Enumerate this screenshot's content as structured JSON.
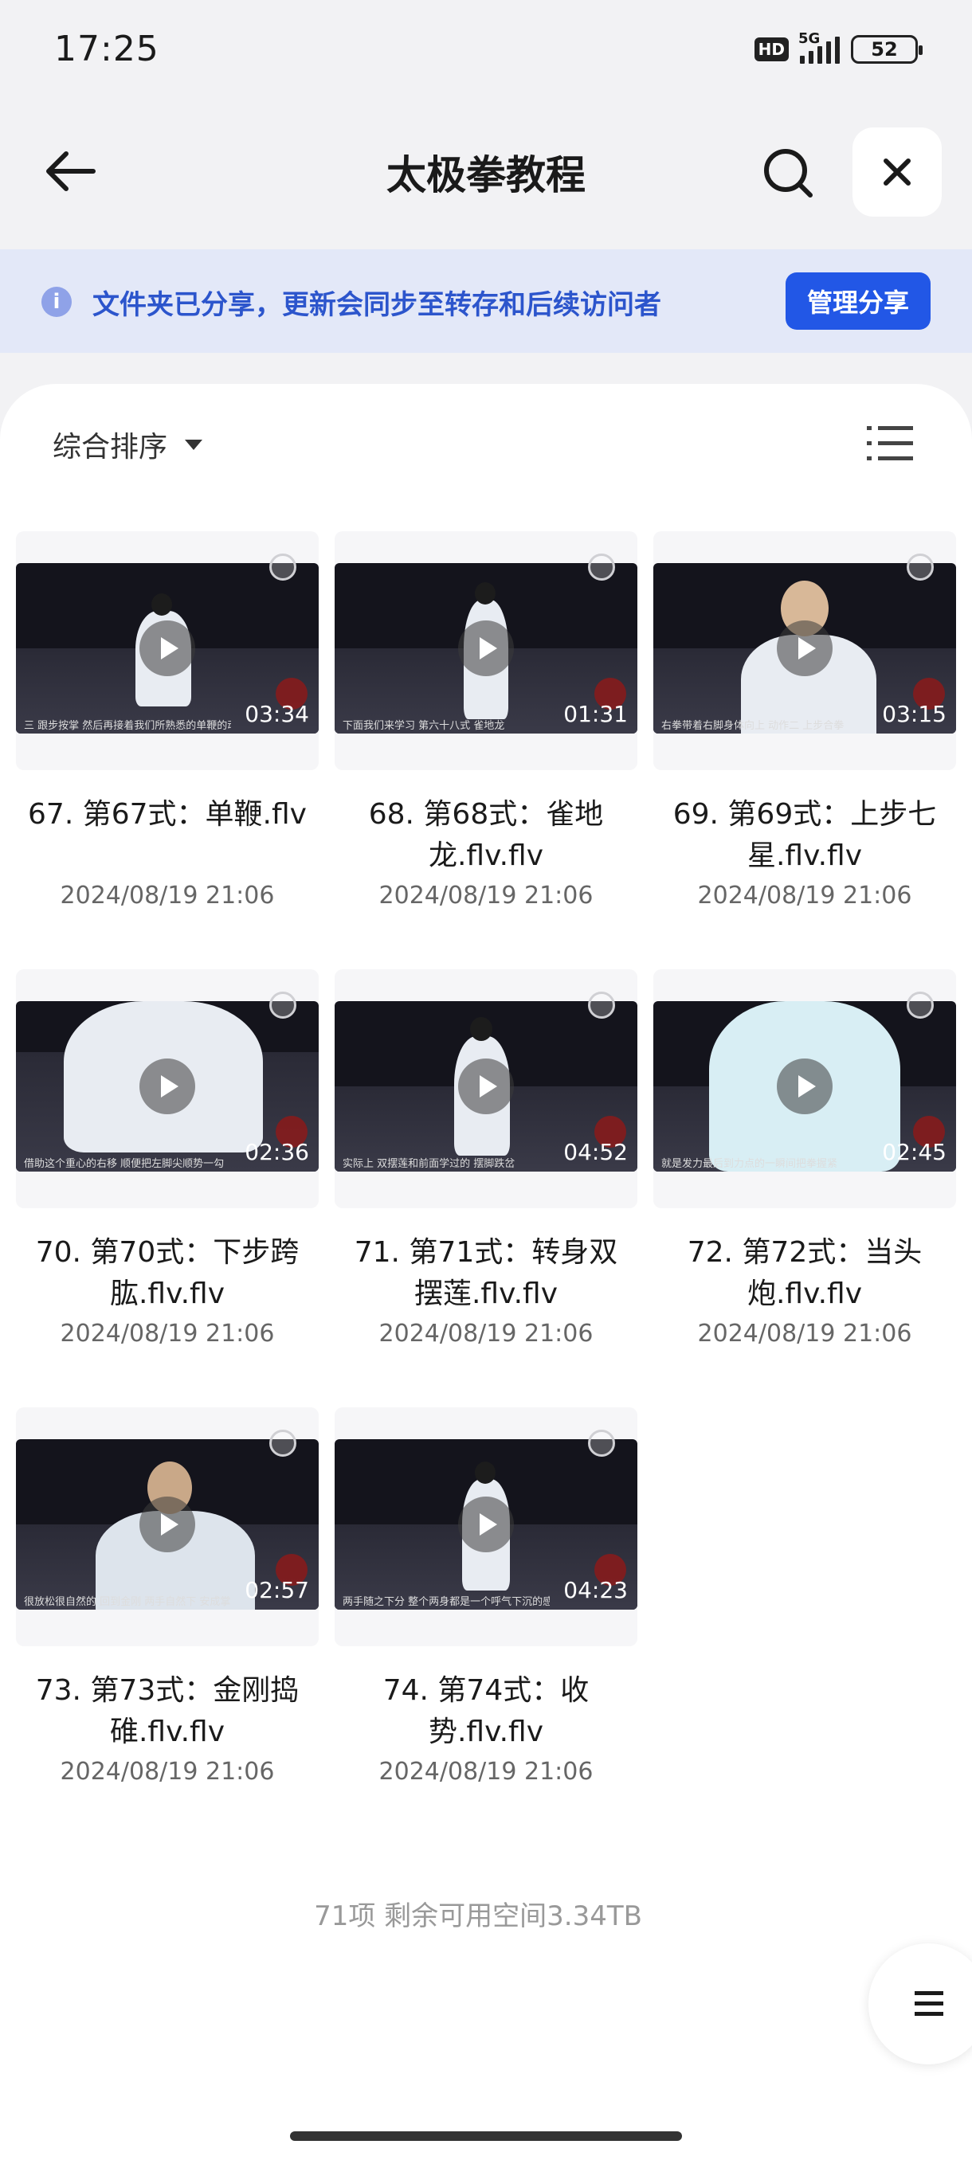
{
  "status_bar": {
    "time": "17:25",
    "hd": "HD",
    "network": "5G",
    "battery": "52"
  },
  "nav": {
    "title": "太极拳教程"
  },
  "share_banner": {
    "text": "文件夹已分享，更新会同步至转存和后续访问者",
    "button": "管理分享"
  },
  "sort": {
    "label": "综合排序"
  },
  "files": [
    {
      "name": "67. 第67式：单鞭.flv",
      "date": "2024/08/19 21:06",
      "duration": "03:34",
      "caption": "三 跟步按掌 然后再接着我们所熟悉的单鞭的动作"
    },
    {
      "name": "68. 第68式：雀地龙.flv.flv",
      "date": "2024/08/19 21:06",
      "duration": "01:31",
      "caption": "下面我们来学习 第六十八式 雀地龙"
    },
    {
      "name": "69. 第69式：上步七星.flv.flv",
      "date": "2024/08/19 21:06",
      "duration": "03:15",
      "caption": "右拳带着右脚身体向上 动作二 上步合拳"
    },
    {
      "name": "70. 第70式：下步跨肱.flv.flv",
      "date": "2024/08/19 21:06",
      "duration": "02:36",
      "caption": "借助这个重心的右移 顺便把左脚尖顺势一勾"
    },
    {
      "name": "71. 第71式：转身双摆莲.flv.flv",
      "date": "2024/08/19 21:06",
      "duration": "04:52",
      "caption": "实际上 双摆莲和前面学过的 摆脚跌岔"
    },
    {
      "name": "72. 第72式：当头炮.flv.flv",
      "date": "2024/08/19 21:06",
      "duration": "02:45",
      "caption": "就是发力最后到力点的一瞬间把拳握紧"
    },
    {
      "name": "73. 第73式：金刚捣碓.flv.flv",
      "date": "2024/08/19 21:06",
      "duration": "02:57",
      "caption": "很放松很自然的 回到金刚 两手自然下 安成掌"
    },
    {
      "name": "74. 第74式：收势.flv.flv",
      "date": "2024/08/19 21:06",
      "duration": "04:23",
      "caption": "两手随之下分 整个两身都是一个呼气下沉的感觉"
    }
  ],
  "footer": {
    "summary": "71项 剩余可用空间3.34TB"
  }
}
